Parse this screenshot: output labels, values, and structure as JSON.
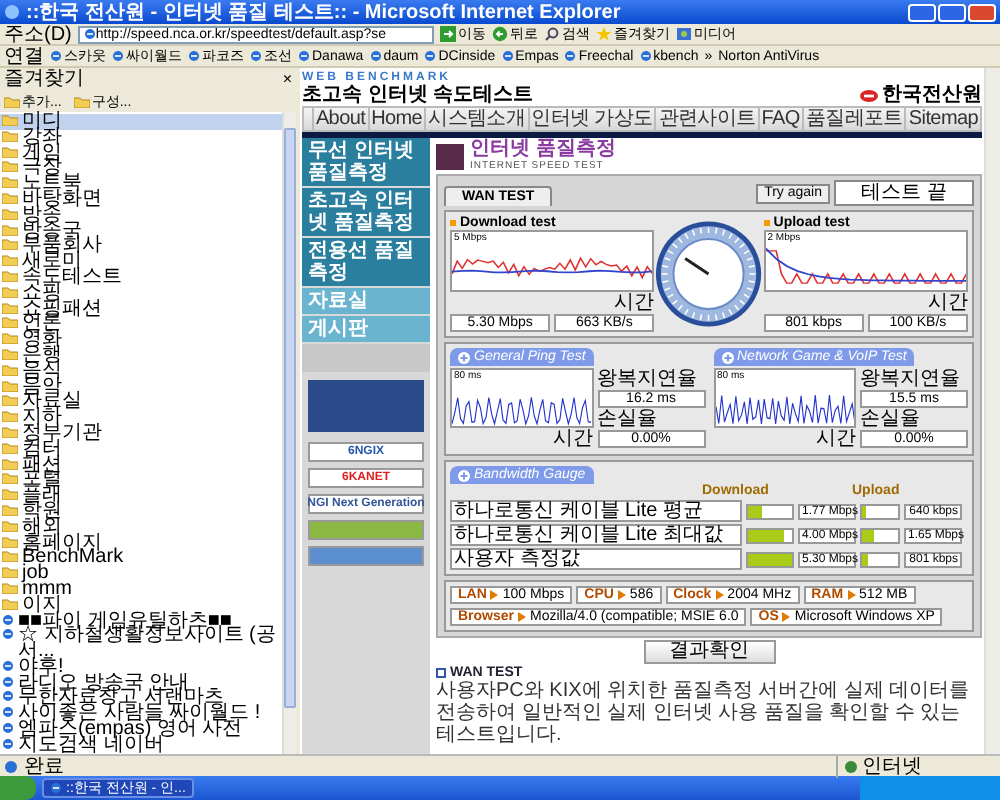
{
  "window": {
    "title": "::한국 전산원 - 인터넷 품질 테스트:: - Microsoft Internet Explorer"
  },
  "address_bar": {
    "label": "주소(D)",
    "url": "http://speed.nca.or.kr/speedtest/default.asp?se",
    "go": "이동"
  },
  "toolbar": [
    {
      "label": "뒤로",
      "kind": "back"
    },
    {
      "label": "검색",
      "kind": "search"
    },
    {
      "label": "즐겨찾기",
      "kind": "favorites"
    },
    {
      "label": "미디어",
      "kind": "media"
    }
  ],
  "links_bar": {
    "label": "연결",
    "links": [
      "스카웃",
      "싸이월드",
      "파코즈",
      "조선",
      "Danawa",
      "daum",
      "DCinside",
      "Empas",
      "Freechal",
      "kbench"
    ],
    "more": "»",
    "extra": "Norton AntiVirus"
  },
  "favorites": {
    "title": "즐겨찾기",
    "close": "×",
    "add": "추가...",
    "organize": "구성...",
    "items": [
      {
        "label": "미디",
        "kind": "folder",
        "selected": true
      },
      {
        "label": "강좌",
        "kind": "folder",
        "selected": false
      },
      {
        "label": "게임",
        "kind": "folder",
        "selected": false
      },
      {
        "label": "극장",
        "kind": "folder",
        "selected": false
      },
      {
        "label": "노트북",
        "kind": "folder",
        "selected": false
      },
      {
        "label": "바탕화면",
        "kind": "folder",
        "selected": false
      },
      {
        "label": "방송",
        "kind": "folder",
        "selected": false
      },
      {
        "label": "방송국",
        "kind": "folder",
        "selected": false
      },
      {
        "label": "부품회사",
        "kind": "folder",
        "selected": false
      },
      {
        "label": "새로미",
        "kind": "folder",
        "selected": false
      },
      {
        "label": "속도테스트",
        "kind": "folder",
        "selected": false
      },
      {
        "label": "쇼핑",
        "kind": "folder",
        "selected": false
      },
      {
        "label": "쇼핑패션",
        "kind": "folder",
        "selected": false
      },
      {
        "label": "언론",
        "kind": "folder",
        "selected": false
      },
      {
        "label": "영화",
        "kind": "folder",
        "selected": false
      },
      {
        "label": "은행",
        "kind": "folder",
        "selected": false
      },
      {
        "label": "음식",
        "kind": "folder",
        "selected": false
      },
      {
        "label": "음악",
        "kind": "folder",
        "selected": false
      },
      {
        "label": "자료실",
        "kind": "folder",
        "selected": false
      },
      {
        "label": "지하",
        "kind": "folder",
        "selected": false
      },
      {
        "label": "정부기관",
        "kind": "folder",
        "selected": false
      },
      {
        "label": "컴터",
        "kind": "folder",
        "selected": false
      },
      {
        "label": "패션",
        "kind": "folder",
        "selected": false
      },
      {
        "label": "포털",
        "kind": "folder",
        "selected": false
      },
      {
        "label": "플래",
        "kind": "folder",
        "selected": false
      },
      {
        "label": "학원",
        "kind": "folder",
        "selected": false
      },
      {
        "label": "해외",
        "kind": "folder",
        "selected": false
      },
      {
        "label": "홈페이지",
        "kind": "folder",
        "selected": false
      },
      {
        "label": "BenchMark",
        "kind": "folder",
        "selected": false
      },
      {
        "label": "job",
        "kind": "folder",
        "selected": false
      },
      {
        "label": "mmm",
        "kind": "folder",
        "selected": false
      },
      {
        "label": "이지",
        "kind": "folder",
        "selected": false
      },
      {
        "label": "■■파이 게임유틸하츠■■",
        "kind": "link",
        "selected": false
      },
      {
        "label": "☆ 지하철생활정보사이트 (공서...",
        "kind": "link",
        "selected": false
      },
      {
        "label": "야후!",
        "kind": "link",
        "selected": false
      },
      {
        "label": "라디오 방송국 안내",
        "kind": "link",
        "selected": false
      },
      {
        "label": "무한자료창고 서랜마츠",
        "kind": "link",
        "selected": false
      },
      {
        "label": "사이좋은 사람들 싸이월드 !",
        "kind": "link",
        "selected": false
      },
      {
        "label": "엠파스(empas) 영어 사전",
        "kind": "link",
        "selected": false
      },
      {
        "label": "지도검색 네이버",
        "kind": "link",
        "selected": false
      }
    ]
  },
  "site": {
    "brand": "WEB BENCHMARK",
    "subtitle": "초고속 인터넷 속도테스트",
    "org": "한국전산원",
    "nav": [
      "About",
      "Home",
      "시스템소개",
      "인터넷 가상도",
      "관련사이트",
      "FAQ",
      "품질레포트",
      "Sitemap"
    ],
    "side_menu": [
      {
        "label": "무선 인터넷 품질측정",
        "kind": "measure"
      },
      {
        "label": "초고속 인터넷 품질측정",
        "kind": "measure"
      },
      {
        "label": "전용선 품질측정",
        "kind": "measure"
      },
      {
        "label": "자료실",
        "kind": "board"
      },
      {
        "label": "게시판",
        "kind": "board"
      }
    ],
    "banners": [
      {
        "label": "6NGIX",
        "color": "#2255aa"
      },
      {
        "label": "6KANET",
        "color": "#dd2222"
      },
      {
        "label": "NGI Next Generation",
        "color": "#335599"
      }
    ],
    "page_title": "인터넷 품질측정",
    "page_subtitle": "INTERNET SPEED TEST"
  },
  "test": {
    "tab": "WAN TEST",
    "try_again": "Try again",
    "status": "테스트 끝",
    "download": {
      "title": "Download test",
      "scale": "5 Mbps",
      "axis": "시간",
      "readings": [
        "5.30 Mbps",
        "663 KB/s"
      ]
    },
    "upload": {
      "title": "Upload test",
      "scale": "2 Mbps",
      "axis": "시간",
      "readings": [
        "801 kbps",
        "100 KB/s"
      ]
    },
    "ping": {
      "button": "General Ping Test",
      "scale": "80 ms",
      "axis": "시간",
      "stats": [
        {
          "label": "왕복지연율",
          "value": "16.2 ms"
        },
        {
          "label": "손실율",
          "value": "0.00%"
        }
      ]
    },
    "game": {
      "button": "Network Game & VoIP Test",
      "scale": "80 ms",
      "axis": "시간",
      "stats": [
        {
          "label": "왕복지연율",
          "value": "15.5 ms"
        },
        {
          "label": "손실율",
          "value": "0.00%"
        }
      ]
    },
    "bandwidth": {
      "button": "Bandwidth Gauge",
      "download_label": "Download",
      "upload_label": "Upload",
      "rows": [
        {
          "label": "하나로통신 케이블 Lite 평균",
          "download": {
            "level": 0.33,
            "reading": "1.77 Mbps"
          },
          "upload": {
            "level": 0.12,
            "reading": "640 kbps"
          }
        },
        {
          "label": "하나로통신 케이블 Lite 최대값",
          "download": {
            "level": 0.8,
            "reading": "4.00 Mbps"
          },
          "upload": {
            "level": 0.35,
            "reading": "1.65 Mbps"
          }
        },
        {
          "label": "사용자 측정값",
          "download": {
            "level": 1.0,
            "reading": "5.30 Mbps"
          },
          "upload": {
            "level": 0.15,
            "reading": "801 kbps"
          }
        }
      ]
    },
    "system": [
      {
        "label": "LAN",
        "value": "100 Mbps"
      },
      {
        "label": "CPU",
        "value": "586"
      },
      {
        "label": "Clock",
        "value": "2004 MHz"
      },
      {
        "label": "RAM",
        "value": "512 MB"
      },
      {
        "label": "Browser",
        "value": "Mozilla/4.0 (compatible; MSIE 6.0"
      },
      {
        "label": "OS",
        "value": "Microsoft Windows XP"
      }
    ]
  },
  "result_button": "결과확인",
  "note": {
    "title": "WAN TEST",
    "text": "사용자PC와 KIX에 위치한 품질측정 서버간에 실제 데이터를 전송하여 일반적인 실제 인터넷 사용 품질을 확인할 수 있는 테스트입니다."
  },
  "status_bar": {
    "text": "완료",
    "zone": "인터넷"
  },
  "taskbar": {
    "task": "::한국 전산원 - 인..."
  }
}
